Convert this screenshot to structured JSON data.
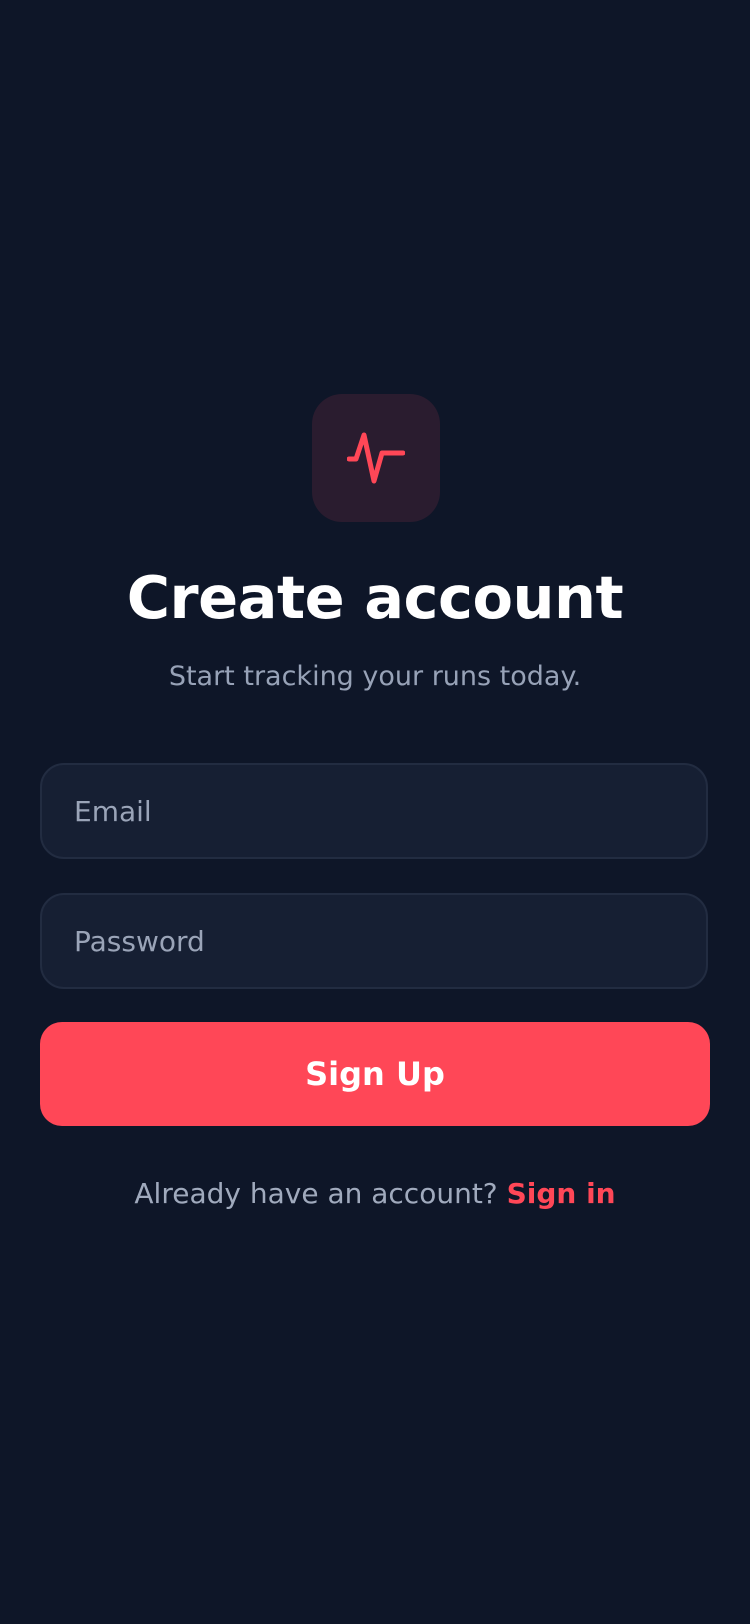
{
  "brand": {
    "icon": "activity-pulse-icon",
    "accent_color": "#ff4757",
    "background_color": "#0e1628"
  },
  "header": {
    "title": "Create account",
    "subtitle": "Start tracking your runs today."
  },
  "form": {
    "email": {
      "placeholder": "Email",
      "value": ""
    },
    "password": {
      "placeholder": "Password",
      "value": ""
    },
    "submit_label": "Sign Up"
  },
  "footer": {
    "prompt": "Already have an account?",
    "link_label": "Sign in"
  }
}
